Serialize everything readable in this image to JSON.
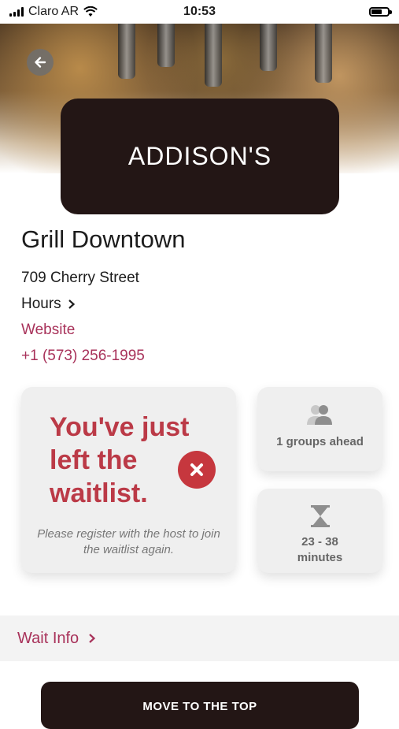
{
  "status_bar": {
    "carrier": "Claro AR",
    "time": "10:53",
    "battery_level": 0.6
  },
  "restaurant": {
    "logo_text": "ADDISON'S",
    "name": "Grill Downtown",
    "address": "709 Cherry Street",
    "hours_label": "Hours",
    "website_label": "Website",
    "phone": "+1 (573) 256-1995"
  },
  "waitlist": {
    "message": "You've just left the waitlist.",
    "sub_message": "Please register with the host to join the waitlist again.",
    "groups_ahead": "1 groups ahead",
    "wait_time": "23 - 38 minutes"
  },
  "wait_info_label": "Wait Info",
  "move_button_label": "MOVE TO THE TOP",
  "colors": {
    "accent": "#a8325a",
    "alert": "#bb3a47",
    "dark": "#231615",
    "card_bg": "#efefef"
  },
  "icons": [
    "back-arrow-icon",
    "chevron-right-icon",
    "close-icon",
    "people-icon",
    "hourglass-icon",
    "wifi-icon"
  ]
}
